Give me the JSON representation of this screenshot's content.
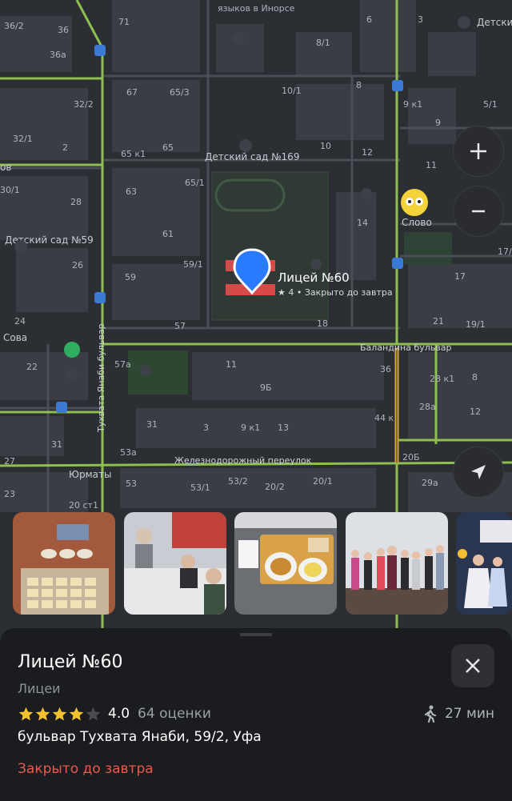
{
  "map": {
    "street_labels": [
      "языков в Инорсе",
      "Баландина бульвар",
      "Тухвата Янаби бульвар",
      "Железнодорожный переулок",
      "Юрматы",
      "ов",
      "Сова"
    ],
    "place_labels": [
      "Детский",
      "Детский сад №169",
      "Детский сад №59",
      "Слово"
    ],
    "house_numbers": [
      "36/2",
      "36",
      "71",
      "6",
      "3",
      "8/1",
      "36а",
      "67",
      "65/3",
      "10/1",
      "8",
      "9 к1",
      "5/1",
      "32/2",
      "9",
      "32/1",
      "2",
      "65 к1",
      "65",
      "10",
      "12",
      "11",
      "30/1",
      "63",
      "65/1",
      "28",
      "14",
      "61",
      "17/",
      "26",
      "59/1",
      "59",
      "17",
      "24",
      "57",
      "18",
      "21",
      "19/1",
      "22",
      "57а",
      "11",
      "36",
      "28 к1",
      "8",
      "9Б",
      "28а",
      "12",
      "31",
      "3",
      "9 к1",
      "13",
      "44 к",
      "31",
      "53а",
      "20Б",
      "27",
      "23",
      "53",
      "53/1",
      "53/2",
      "20/2",
      "20/1",
      "29а",
      "20 ст1"
    ],
    "selected_place": {
      "name": "Лицей №60",
      "subtitle": "★ 4 • Закрыто до завтра"
    },
    "controls": {
      "zoom_in_icon": "plus-icon",
      "zoom_out_icon": "minus-icon",
      "location_icon": "navigation-arrow-icon"
    },
    "colors": {
      "road_major": "#8fbf4e",
      "road_highlight": "#d6a43a",
      "pin": "#2a7bff",
      "school_marker": "#d84a4a"
    }
  },
  "place": {
    "name": "Лицей №60",
    "category": "Лицеи",
    "rating": 4.0,
    "rating_text": "4.0",
    "reviews": "64 оценки",
    "walk_time": "27 мин",
    "address": "бульвар Тухвата Янаби, 59/2, Уфа",
    "status": "Закрыто до завтра",
    "status_color": "#e85a4f"
  }
}
